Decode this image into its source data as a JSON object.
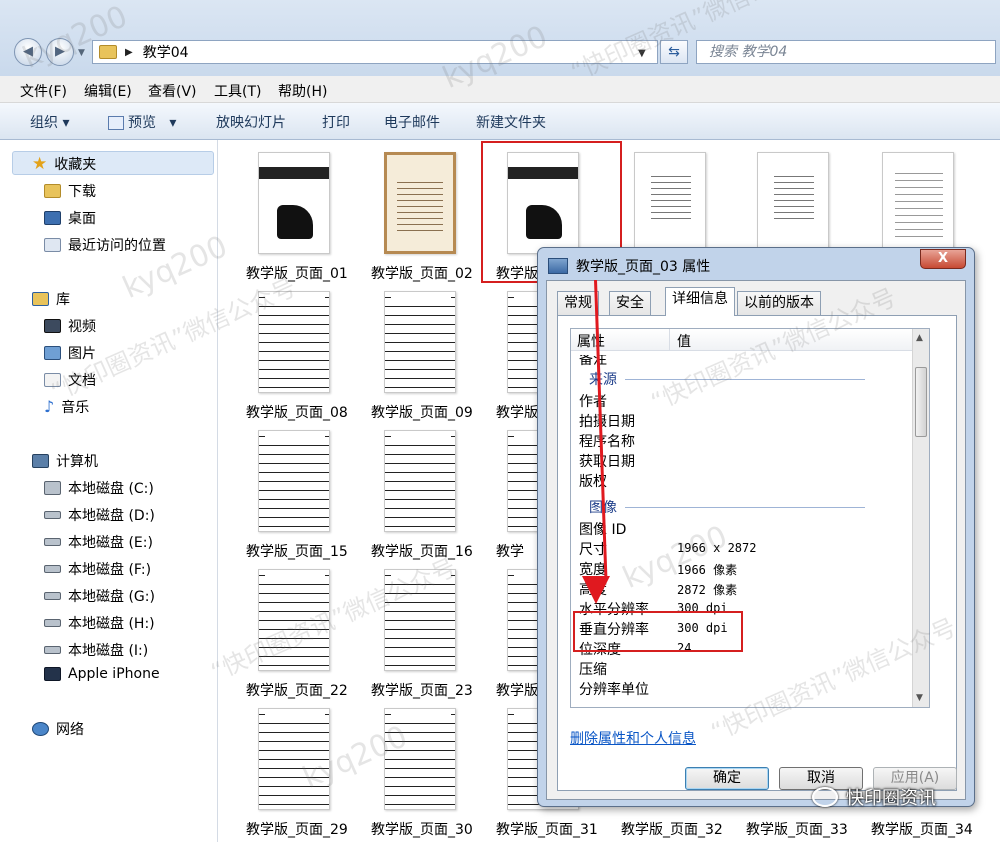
{
  "address": {
    "path": "教学04",
    "search_placeholder": "搜索 教学04"
  },
  "menu": [
    "文件(F)",
    "编辑(E)",
    "查看(V)",
    "工具(T)",
    "帮助(H)"
  ],
  "toolbar": {
    "organize": "组织",
    "preview": "预览",
    "slideshow": "放映幻灯片",
    "print": "打印",
    "email": "电子邮件",
    "new_folder": "新建文件夹"
  },
  "sidebar": {
    "favorites": "收藏夹",
    "downloads": "下载",
    "desktop": "桌面",
    "recent": "最近访问的位置",
    "library": "库",
    "video": "视频",
    "pictures": "图片",
    "documents": "文档",
    "music": "音乐",
    "computer": "计算机",
    "drives": [
      "本地磁盘 (C:)",
      "本地磁盘 (D:)",
      "本地磁盘 (E:)",
      "本地磁盘 (F:)",
      "本地磁盘 (G:)",
      "本地磁盘 (H:)",
      "本地磁盘 (I:)"
    ],
    "iphone": "Apple iPhone",
    "network": "网络"
  },
  "files": {
    "r0": [
      "教学版_页面_01",
      "教学版_页面_02",
      "教学版"
    ],
    "r1": [
      "教学版_页面_08",
      "教学版_页面_09",
      "教学版"
    ],
    "r2": [
      "教学版_页面_15",
      "教学版_页面_16",
      "教学"
    ],
    "r3": [
      "教学版_页面_22",
      "教学版_页面_23",
      "教学版"
    ],
    "r4": [
      "教学版_页面_29",
      "教学版_页面_30",
      "教学版_页面_31",
      "教学版_页面_32",
      "教学版_页面_33",
      "教学版_页面_34"
    ]
  },
  "dialog": {
    "title": "教学版_页面_03 属性",
    "close": "X",
    "tabs": [
      "常规",
      "安全",
      "详细信息",
      "以前的版本"
    ],
    "col_property": "属性",
    "col_value": "值",
    "partial_row": "备注",
    "section_origin": "来源",
    "origin_rows": [
      "作者",
      "拍摄日期",
      "程序名称",
      "获取日期",
      "版权"
    ],
    "section_image": "图像",
    "image_rows": [
      {
        "label": "图像 ID",
        "value": ""
      },
      {
        "label": "尺寸",
        "value": "1966 x 2872"
      },
      {
        "label": "宽度",
        "value": "1966 像素"
      },
      {
        "label": "高度",
        "value": "2872 像素"
      },
      {
        "label": "水平分辨率",
        "value": "300 dpi"
      },
      {
        "label": "垂直分辨率",
        "value": "300 dpi"
      },
      {
        "label": "位深度",
        "value": "24"
      },
      {
        "label": "压缩",
        "value": ""
      },
      {
        "label": "分辨率单位",
        "value": ""
      }
    ],
    "remove_link": "删除属性和个人信息",
    "ok": "确定",
    "cancel": "取消",
    "apply": "应用(A)"
  },
  "watermark": {
    "account": "kyq200",
    "source": "“快印圈资讯”微信公众号"
  },
  "badge": "快印圈资讯"
}
